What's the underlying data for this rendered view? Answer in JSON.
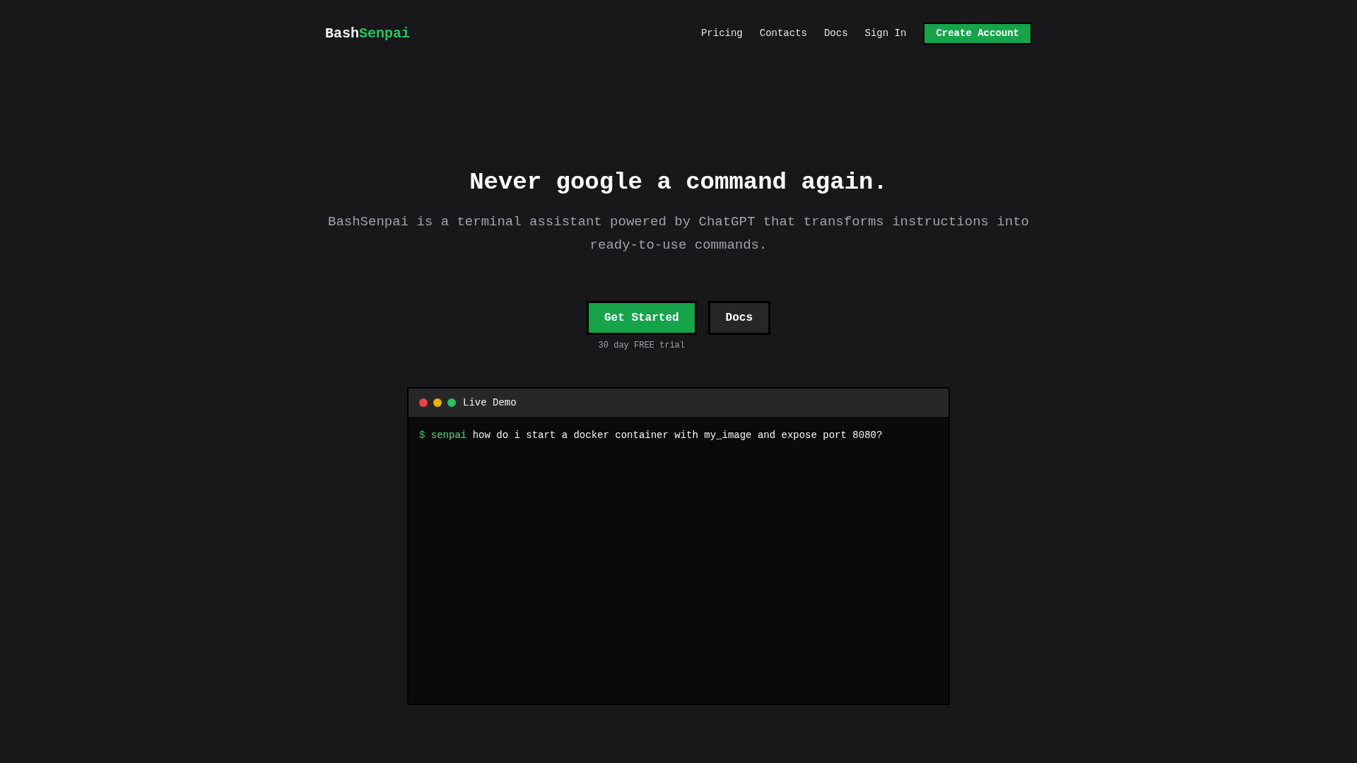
{
  "nav": {
    "logo": {
      "first": "Bash",
      "second": "Senpai"
    },
    "links": [
      "Pricing",
      "Contacts",
      "Docs",
      "Sign In"
    ],
    "cta": "Create Account"
  },
  "hero": {
    "title": "Never google a command again.",
    "subtitle": "BashSenpai is a terminal assistant powered by ChatGPT that transforms instructions into ready-to-use commands.",
    "buttons": [
      {
        "label": "Get Started",
        "kind": "primary"
      },
      {
        "label": "Docs",
        "kind": "secondary"
      }
    ],
    "note": "30 day FREE trial"
  },
  "terminal": {
    "title": "Live Demo",
    "dots": [
      {
        "color": "#ef4444"
      },
      {
        "color": "#eab308"
      },
      {
        "color": "#22c55e"
      }
    ],
    "lines": [
      {
        "prompt": "$",
        "command": "senpai",
        "text": "how do i start a docker container with my_image and expose port 8080?"
      }
    ]
  }
}
